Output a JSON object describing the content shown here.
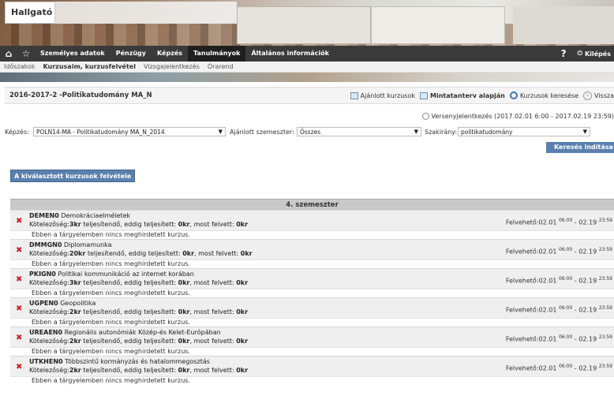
{
  "brand": "Hallgató",
  "mainnav": {
    "items": [
      "Személyes adatok",
      "Pénzügy",
      "Képzés",
      "Tanulmányok",
      "Általános információk"
    ],
    "active": "Tanulmányok",
    "help": "?",
    "logout": "Kilépés"
  },
  "subnav": {
    "items": [
      "Időszakok",
      "Kurzusaim, kurzusfelvétel",
      "Vizsgajelentkezés",
      "Órarend"
    ],
    "active": "Kurzusaim, kurzusfelvétel"
  },
  "titlebar": {
    "title": "2016-2017-2 -Politikatudomány MA_N",
    "actions": [
      "Ajánlott kurzusok",
      "Mintatanterv alapján",
      "Kurzusok keresése",
      "Vissza"
    ]
  },
  "registration": "Versenyjelentkezés (2017.02.01 6:00 - 2017.02.19 23:59)",
  "filters": {
    "kepzes_label": "Képzés:",
    "kepzes_value": "POLN14-MA - Politikatudomány MA_N_2014",
    "szemeszter_label": "Ajánlott szemeszter:",
    "szemeszter_value": "Összes",
    "szakirany_label": "Szakirány:",
    "szakirany_value": "politikatudomány"
  },
  "search_button": "Keresés indítása",
  "add_button": "A kiválasztott kurzusok felvétele",
  "semester": "4. szemeszter",
  "no_course_text": "Ebben a tárgyelemben nincs meghirdetett kurzus.",
  "felveheto": {
    "prefix": "Felvehető:",
    "start_date": "02.01",
    "start_time": "06:00",
    "sep": " - ",
    "end_date": "02.19",
    "end_time": "23:59"
  },
  "courses": [
    {
      "code": "DEMEN0",
      "name": "Demokráciaelméletek",
      "kotelezoseg": "Kötelezőség:",
      "credit": "3kr",
      "req_text": "teljesítendő, eddig teljesített:",
      "done": "0kr",
      "now_text": "most felvett:",
      "now": "0kr"
    },
    {
      "code": "DMMGN0",
      "name": "Diplomamunka",
      "kotelezoseg": "Kötelezőség:",
      "credit": "20kr",
      "req_text": "teljesítendő, eddig teljesített:",
      "done": "0kr",
      "now_text": "most felvett:",
      "now": "0kr"
    },
    {
      "code": "PKIGN0",
      "name": "Politikai kommunikáció az internet korában",
      "kotelezoseg": "Kötelezőség:",
      "credit": "3kr",
      "req_text": "teljesítendő, eddig teljesített:",
      "done": "0kr",
      "now_text": "most felvett:",
      "now": "0kr"
    },
    {
      "code": "UGPEN0",
      "name": "Geopolitika",
      "kotelezoseg": "Kötelezőség:",
      "credit": "2kr",
      "req_text": "teljesítendő, eddig teljesített:",
      "done": "0kr",
      "now_text": "most felvett:",
      "now": "0kr"
    },
    {
      "code": "UREAEN0",
      "name": "Regionális autonómiák Közép-és Kelet-Európában",
      "kotelezoseg": "Kötelezőség:",
      "credit": "2kr",
      "req_text": "teljesítendő, eddig teljesített:",
      "done": "0kr",
      "now_text": "most felvett:",
      "now": "0kr"
    },
    {
      "code": "UTKHEN0",
      "name": "Többszintű kormányzás és hatalommegosztás",
      "kotelezoseg": "Kötelezőség:",
      "credit": "2kr",
      "req_text": "teljesítendő, eddig teljesített:",
      "done": "0kr",
      "now_text": "most felvett:",
      "now": "0kr"
    }
  ]
}
